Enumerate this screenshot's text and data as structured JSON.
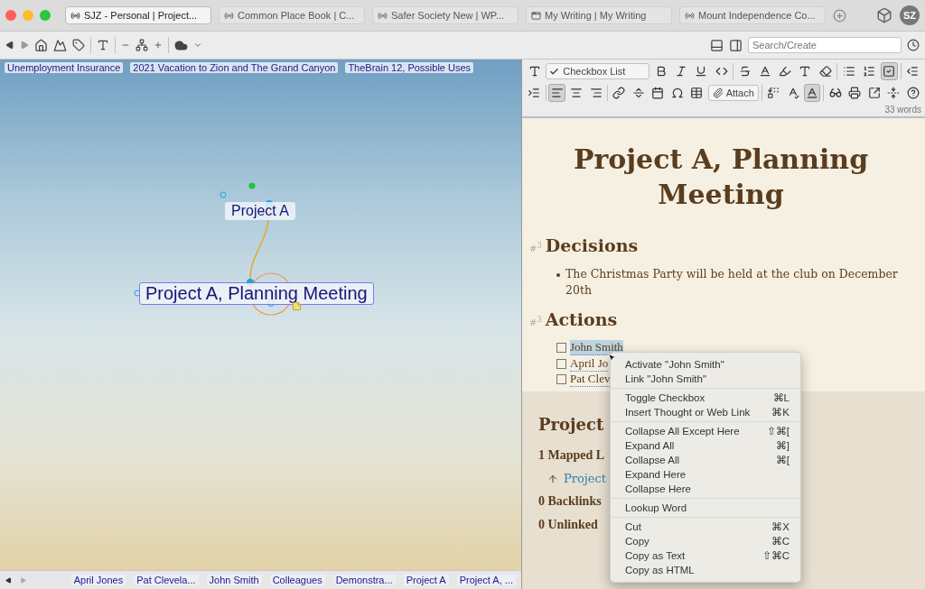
{
  "tabs": [
    {
      "label": "SJZ - Personal | Project...",
      "kind": "brain",
      "selected": true
    },
    {
      "label": "Common Place Book | C...",
      "kind": "brain",
      "selected": false
    },
    {
      "label": "Safer Society New | WP...",
      "kind": "brain",
      "selected": false
    },
    {
      "label": "My Writing | My Writing",
      "kind": "page",
      "selected": false
    },
    {
      "label": "Mount Independence Co...",
      "kind": "brain",
      "selected": false
    }
  ],
  "user": {
    "initials": "SZ"
  },
  "search": {
    "placeholder": "Search/Create"
  },
  "pins": [
    "Unemployment Insurance",
    "2021 Vacation to Zion and The Grand Canyon",
    "TheBrain 12, Possible Uses"
  ],
  "canvas": {
    "nodes": [
      {
        "label": "Project A",
        "kind": "parent"
      },
      {
        "label": "Project A, Planning Meeting",
        "kind": "active"
      }
    ]
  },
  "history": [
    "April Jones",
    "Pat Clevela...",
    "John Smith",
    "Colleagues",
    "Demonstra...",
    "Project A",
    "Project A, ..."
  ],
  "editor": {
    "rows": [
      [
        {
          "kind": "text-size",
          "active": false
        },
        {
          "kind": "select",
          "label": "Checkbox List"
        },
        {
          "kind": "bold",
          "active": false
        },
        {
          "kind": "italic",
          "active": false
        },
        {
          "kind": "underline",
          "active": false
        },
        {
          "kind": "code",
          "active": false
        },
        {
          "kind": "sep"
        },
        {
          "kind": "strike",
          "active": false
        },
        {
          "kind": "color",
          "active": false
        },
        {
          "kind": "highlight",
          "active": false
        },
        {
          "kind": "font",
          "active": false
        },
        {
          "kind": "eraser",
          "active": false
        },
        {
          "kind": "sep"
        },
        {
          "kind": "bullets",
          "active": false
        },
        {
          "kind": "numbers",
          "active": false
        },
        {
          "kind": "checklist",
          "active": true
        },
        {
          "kind": "sep"
        },
        {
          "kind": "outdent",
          "active": false
        }
      ],
      [
        {
          "kind": "indent",
          "active": false
        },
        {
          "kind": "sep"
        },
        {
          "kind": "align-left",
          "active": true
        },
        {
          "kind": "align-center",
          "active": false
        },
        {
          "kind": "align-right",
          "active": false
        },
        {
          "kind": "sep"
        },
        {
          "kind": "link",
          "active": false
        },
        {
          "kind": "rule",
          "active": false
        },
        {
          "kind": "calendar",
          "active": false
        },
        {
          "kind": "omega",
          "active": false
        },
        {
          "kind": "table",
          "active": false
        },
        {
          "kind": "attach",
          "label": "Attach"
        },
        {
          "kind": "sep"
        },
        {
          "kind": "replace",
          "active": false
        },
        {
          "kind": "spell",
          "active": false
        },
        {
          "kind": "spell-check",
          "active": true
        },
        {
          "kind": "sep"
        },
        {
          "kind": "private",
          "active": false
        },
        {
          "kind": "print",
          "active": false
        },
        {
          "kind": "export",
          "active": false
        },
        {
          "kind": "collapse",
          "active": false
        },
        {
          "kind": "help",
          "active": false
        }
      ]
    ],
    "word_count": "33 words"
  },
  "note": {
    "title": "Project A, Planning Meeting",
    "sections": [
      {
        "marker": "#$^{3}$",
        "heading": "Decisions",
        "kind": "bullets",
        "items": [
          {
            "text": "The Christmas Party will be held at the club on December 20th"
          }
        ]
      },
      {
        "marker": "#$^{3}$",
        "heading": "Actions",
        "kind": "tasks",
        "items": [
          {
            "text": "John Smith",
            "checked": false,
            "selected": true
          },
          {
            "text": "April Jo",
            "checked": false,
            "selected": false
          },
          {
            "text": "Pat Clev",
            "checked": false,
            "selected": false
          }
        ]
      }
    ]
  },
  "links": {
    "heading": "Project",
    "items": [
      {
        "kind": "label",
        "text": "1 Mapped L"
      },
      {
        "kind": "link",
        "text": "Project"
      },
      {
        "kind": "label",
        "text": "0 Backlinks"
      },
      {
        "kind": "label",
        "text": "0 Unlinked"
      }
    ]
  },
  "context_menu": {
    "groups": [
      [
        {
          "label": "Activate \"John Smith\""
        },
        {
          "label": "Link \"John Smith\""
        }
      ],
      [
        {
          "label": "Toggle Checkbox",
          "shortcut": "⌘L"
        },
        {
          "label": "Insert Thought or Web Link",
          "shortcut": "⌘K"
        }
      ],
      [
        {
          "label": "Collapse All Except Here",
          "shortcut": "⇧⌘["
        },
        {
          "label": "Expand All",
          "shortcut": "⌘]"
        },
        {
          "label": "Collapse All",
          "shortcut": "⌘["
        },
        {
          "label": "Expand Here"
        },
        {
          "label": "Collapse Here"
        }
      ],
      [
        {
          "label": "Lookup Word"
        }
      ],
      [
        {
          "label": "Cut",
          "shortcut": "⌘X"
        },
        {
          "label": "Copy",
          "shortcut": "⌘C"
        },
        {
          "label": "Copy as Text",
          "shortcut": "⇧⌘C"
        },
        {
          "label": "Copy as HTML"
        }
      ]
    ]
  }
}
